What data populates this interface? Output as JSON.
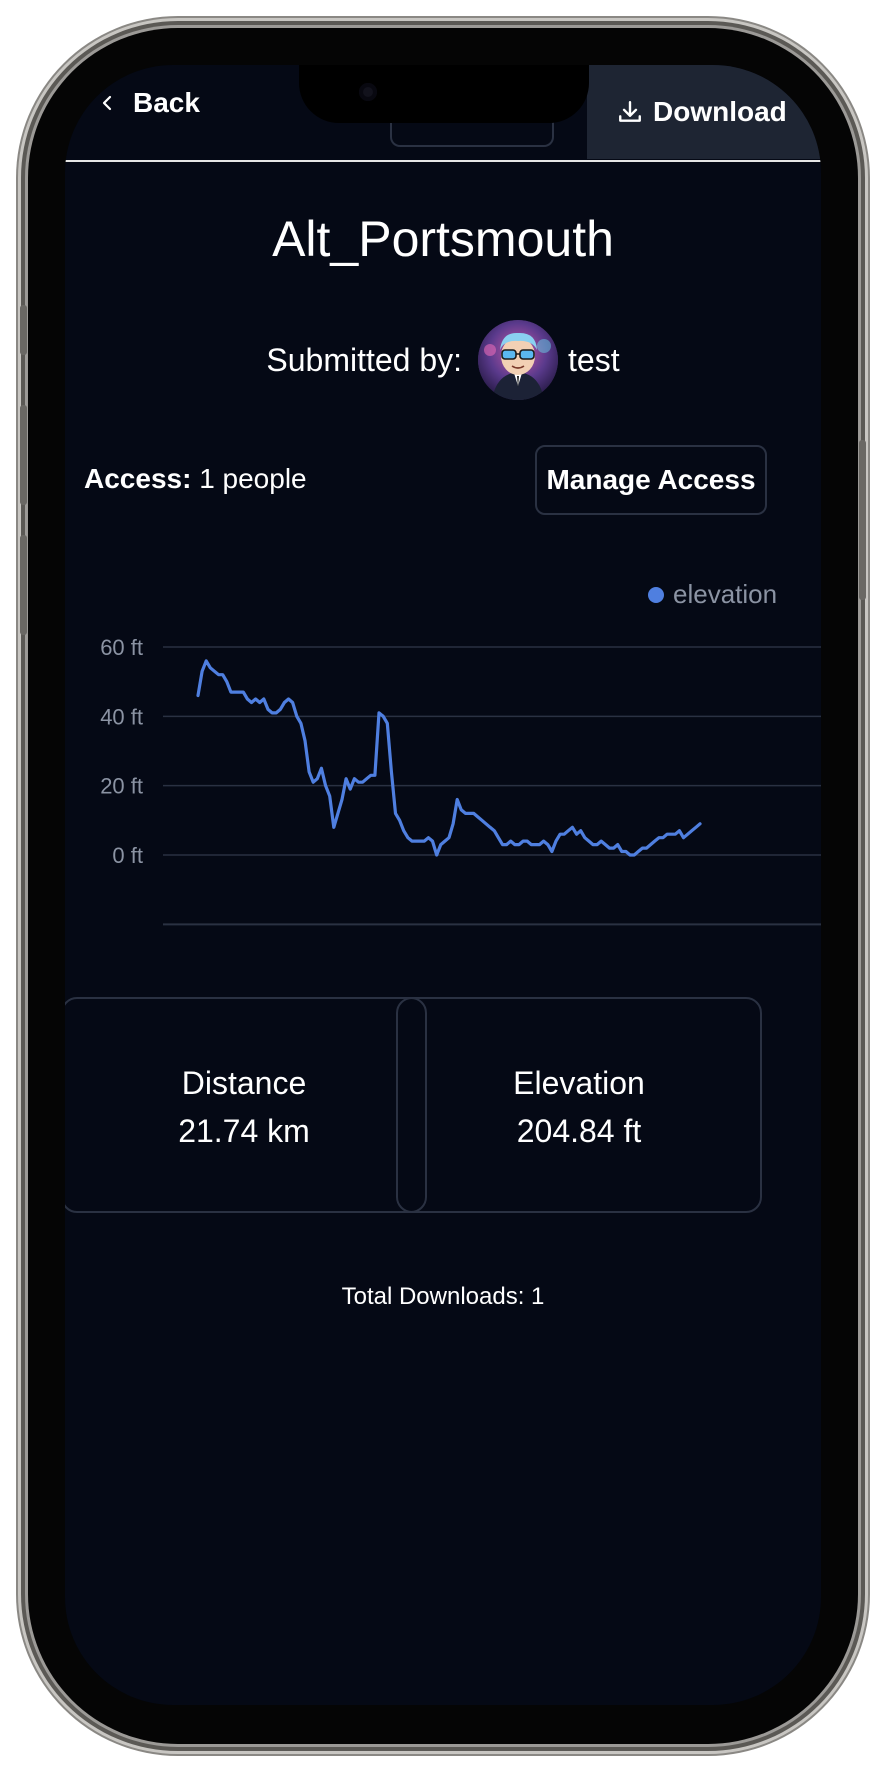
{
  "nav": {
    "back_label": "Back",
    "download_label": "Download"
  },
  "route": {
    "title": "Alt_Portsmouth",
    "submitted_by_label": "Submitted by:",
    "username": "test"
  },
  "access": {
    "label": "Access:",
    "value": "1 people",
    "manage_label": "Manage Access"
  },
  "chart_data": {
    "type": "line",
    "series": [
      {
        "name": "elevation",
        "color": "#4f7fe0"
      }
    ],
    "y_ticks": [
      "60 ft",
      "40 ft",
      "20 ft",
      "0 ft"
    ],
    "ylim": [
      -20,
      60
    ],
    "grid": true,
    "legend_position": "top-right",
    "values": [
      46,
      53,
      56,
      54,
      53,
      52,
      52,
      50,
      47,
      47,
      47,
      47,
      45,
      44,
      45,
      44,
      45,
      42,
      41,
      41,
      42,
      44,
      45,
      44,
      40,
      38,
      33,
      24,
      21,
      22,
      25,
      20,
      17,
      8,
      12,
      16,
      22,
      19,
      22,
      21,
      21,
      22,
      23,
      23,
      41,
      40,
      38,
      24,
      12,
      10,
      7,
      5,
      4,
      4,
      4,
      4,
      5,
      4,
      0,
      3,
      4,
      5,
      9,
      16,
      13,
      12,
      12,
      12,
      11,
      10,
      9,
      8,
      7,
      5,
      3,
      3,
      4,
      3,
      3,
      4,
      4,
      3,
      3,
      3,
      4,
      3,
      1,
      4,
      6,
      6,
      7,
      8,
      6,
      7,
      5,
      4,
      3,
      3,
      4,
      3,
      2,
      2,
      3,
      1,
      1,
      0,
      0,
      1,
      2,
      2,
      3,
      4,
      5,
      5,
      6,
      6,
      6,
      7,
      5,
      6,
      7,
      8,
      9
    ]
  },
  "stats": {
    "distance_label": "Distance",
    "distance_value": "21.74 km",
    "elevation_label": "Elevation",
    "elevation_value": "204.84 ft"
  },
  "footer": {
    "downloads_text": "Total Downloads: 1"
  },
  "colors": {
    "background": "#050915",
    "accent_line": "#4f7fe0",
    "card_border": "#2a3142"
  }
}
